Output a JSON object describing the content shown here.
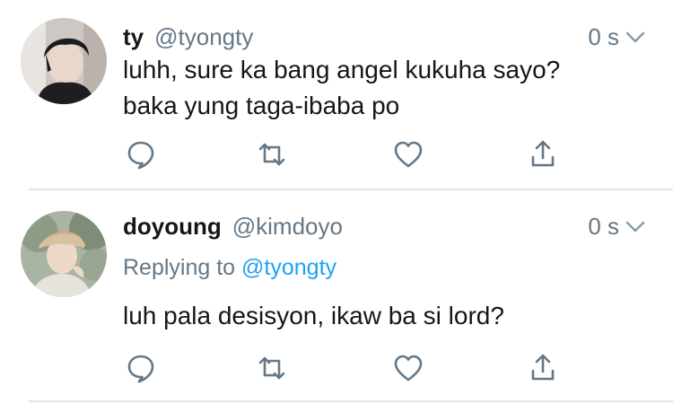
{
  "tweets": [
    {
      "display_name": "ty",
      "handle": "@tyongty",
      "time": "0 s",
      "lines": [
        "luhh, sure ka bang angel kukuha sayo?",
        "baka yung taga-ibaba po"
      ],
      "avatar": "avatar-ty"
    },
    {
      "display_name": "doyoung",
      "handle": "@kimdoyo",
      "time": "0 s",
      "replying_prefix": "Replying to ",
      "replying_to": "@tyongty",
      "lines": [
        "luh pala desisyon, ikaw ba si lord?"
      ],
      "avatar": "avatar-doyoung"
    }
  ],
  "icons": {
    "reply": "reply-icon",
    "retweet": "retweet-icon",
    "like": "heart-icon",
    "share": "share-icon",
    "more": "chevron-down-icon"
  },
  "colors": {
    "text_primary": "#14171a",
    "text_secondary": "#657786",
    "mention": "#1da1f2",
    "icon": "#657786",
    "divider": "#dfe3e7"
  }
}
